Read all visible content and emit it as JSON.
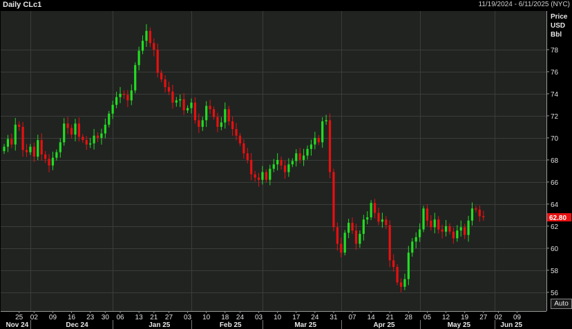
{
  "header": {
    "title": "Daily CLc1",
    "date_range": "11/19/2024 - 6/11/2025 (NYC)"
  },
  "controls": {
    "auto_label": "Auto"
  },
  "colors": {
    "background": "#000000",
    "plot_background": "#212321",
    "grid": "#3a3d3a",
    "up": "#22dd22",
    "down": "#e81010",
    "last_price_tag": "#e81010"
  },
  "chart_data": {
    "type": "candlestick",
    "y_unit_labels": [
      "Price",
      "USD",
      "Bbl"
    ],
    "ylim": [
      54.3,
      81.5
    ],
    "y_ticks": [
      56,
      58,
      60,
      62,
      64,
      66,
      68,
      70,
      72,
      74,
      76,
      78
    ],
    "last_price": 62.8,
    "last_price_label": "62.80",
    "day_ticks": [
      {
        "label": "25",
        "i": 4
      },
      {
        "label": "02",
        "i": 8
      },
      {
        "label": "09",
        "i": 13
      },
      {
        "label": "16",
        "i": 18
      },
      {
        "label": "23",
        "i": 23
      },
      {
        "label": "30",
        "i": 27
      },
      {
        "label": "06",
        "i": 31
      },
      {
        "label": "13",
        "i": 36
      },
      {
        "label": "21",
        "i": 40
      },
      {
        "label": "27",
        "i": 44
      },
      {
        "label": "03",
        "i": 49
      },
      {
        "label": "10",
        "i": 54
      },
      {
        "label": "18",
        "i": 59
      },
      {
        "label": "24",
        "i": 63
      },
      {
        "label": "03",
        "i": 68
      },
      {
        "label": "10",
        "i": 73
      },
      {
        "label": "17",
        "i": 78
      },
      {
        "label": "24",
        "i": 83
      },
      {
        "label": "31",
        "i": 88
      },
      {
        "label": "07",
        "i": 93
      },
      {
        "label": "14",
        "i": 98
      },
      {
        "label": "21",
        "i": 103
      },
      {
        "label": "28",
        "i": 108
      },
      {
        "label": "05",
        "i": 113
      },
      {
        "label": "12",
        "i": 118
      },
      {
        "label": "19",
        "i": 123
      },
      {
        "label": "27",
        "i": 128
      },
      {
        "label": "02",
        "i": 132
      },
      {
        "label": "09",
        "i": 137
      }
    ],
    "months": [
      {
        "label": "Nov 24",
        "i": 2
      },
      {
        "label": "Dec 24",
        "i": 18
      },
      {
        "label": "Jan 25",
        "i": 40
      },
      {
        "label": "Feb 25",
        "i": 59
      },
      {
        "label": "Mar 25",
        "i": 79
      },
      {
        "label": "Apr 25",
        "i": 100
      },
      {
        "label": "May 25",
        "i": 120
      },
      {
        "label": "Jun 25",
        "i": 134
      }
    ],
    "month_boundaries": [
      7,
      29,
      50,
      69,
      90,
      111,
      131
    ],
    "close": [
      69.2,
      69.9,
      69.4,
      71.2,
      71.0,
      68.9,
      68.7,
      69.2,
      68.3,
      69.8,
      68.5,
      68.1,
      67.5,
      68.2,
      68.7,
      69.6,
      71.3,
      70.9,
      70.3,
      71.3,
      70.1,
      69.8,
      69.4,
      69.5,
      70.2,
      70.0,
      70.4,
      71.2,
      72.2,
      73.0,
      73.7,
      74.0,
      73.9,
      73.4,
      74.3,
      76.6,
      77.9,
      78.8,
      79.7,
      78.6,
      78.0,
      75.9,
      75.3,
      74.6,
      74.2,
      73.2,
      73.4,
      73.5,
      72.5,
      72.7,
      73.2,
      71.6,
      71.0,
      71.6,
      72.9,
      72.6,
      71.9,
      71.0,
      71.4,
      72.6,
      71.5,
      70.8,
      70.2,
      69.5,
      68.6,
      68.0,
      66.7,
      66.4,
      66.2,
      66.9,
      66.2,
      67.2,
      67.6,
      68.0,
      67.5,
      66.9,
      67.6,
      67.9,
      68.6,
      68.0,
      68.4,
      69.0,
      69.4,
      70.0,
      69.6,
      71.5,
      71.6,
      66.9,
      61.9,
      60.4,
      59.6,
      61.4,
      62.3,
      61.6,
      60.4,
      61.3,
      62.6,
      62.8,
      64.1,
      63.2,
      62.4,
      62.6,
      62.1,
      58.9,
      58.3,
      56.9,
      56.5,
      57.2,
      59.6,
      60.6,
      61.0,
      61.7,
      63.6,
      62.5,
      61.9,
      62.6,
      61.7,
      61.5,
      62.0,
      61.5,
      60.9,
      61.6,
      61.9,
      61.2,
      62.5,
      63.6,
      63.5,
      62.9,
      62.8
    ]
  }
}
